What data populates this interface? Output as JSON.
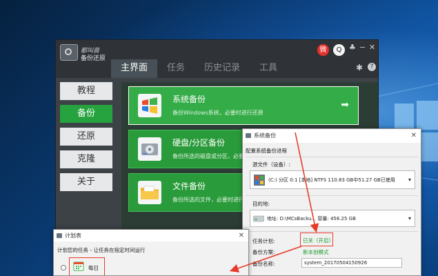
{
  "app": {
    "logo_line1": "都叫兽",
    "logo_line2": "备份还原",
    "tabs": [
      {
        "label": "主界面",
        "active": true
      },
      {
        "label": "任务",
        "active": false
      },
      {
        "label": "历史记录",
        "active": false
      },
      {
        "label": "工具",
        "active": false
      }
    ],
    "icons": [
      "weibo-icon",
      "qq-icon",
      "gear-icon",
      "help-icon"
    ],
    "window_controls": {
      "shirt": "♣",
      "minimize": "−",
      "close": "✕"
    },
    "settings_glyph": "✱",
    "help_glyph": "?"
  },
  "sidebar": {
    "items": [
      {
        "label": "教程",
        "active": false
      },
      {
        "label": "备份",
        "active": true
      },
      {
        "label": "还原",
        "active": false
      },
      {
        "label": "克隆",
        "active": false
      },
      {
        "label": "关于",
        "active": false
      }
    ]
  },
  "cards": [
    {
      "title": "系统备份",
      "desc": "备份Windows系统，必要时进行还原",
      "icon": "windows-icon",
      "arrow": "➡"
    },
    {
      "title": "硬盘/分区备份",
      "desc": "备份所选的磁盘或分区，必要时进行还原",
      "icon": "harddisk-icon"
    },
    {
      "title": "文件备份",
      "desc": "备份所选的文件，必要时进行还原",
      "icon": "folder-icon"
    }
  ],
  "backup_dialog": {
    "title": "系统备份",
    "close": "✕",
    "heading": "配置系统备份进程",
    "source_label": "源文件（设备）:",
    "source_value": "(C:) 分区 0:1 [本地]    NTFS    110.83 GB中51.27 GB已使用",
    "dest_label": "目的地:",
    "dest_value": "地址: D:\\MCsBacku...  容量: 456.25 GB",
    "schedule_label": "任务计划:",
    "schedule_value": "已关（开启）",
    "plan_label": "备份方案:",
    "plan_value": "新本创模式",
    "name_label": "备份名称:",
    "name_value": "system_20170504150926",
    "dropdown_arrow": "▾"
  },
  "schedule_dialog": {
    "title": "计划表",
    "close": "✕",
    "subtitle": "计划您的任务 - 让任务在指定时间运行",
    "option_daily": "每日"
  },
  "colors": {
    "accent_green": "#26a33e",
    "annotation_red": "#e53b2b",
    "link_green": "#1a9a2e"
  }
}
